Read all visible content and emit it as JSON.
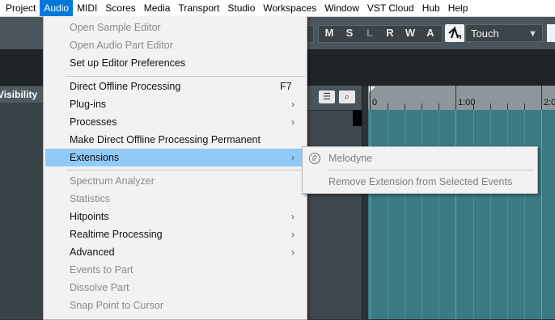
{
  "menubar": {
    "items": [
      "Project",
      "Audio",
      "MIDI",
      "Scores",
      "Media",
      "Transport",
      "Studio",
      "Workspaces",
      "Window",
      "VST Cloud",
      "Hub",
      "Help"
    ],
    "active_index": 1
  },
  "toolbar": {
    "buttons": [
      "M",
      "S",
      "L",
      "R",
      "W",
      "A"
    ],
    "automation_mode": "Touch"
  },
  "left_panel": {
    "visibility_label": "Visibility"
  },
  "ruler": {
    "labels": [
      "0",
      "1:00",
      "2:0"
    ]
  },
  "audio_menu": {
    "items": [
      {
        "label": "Open Sample Editor",
        "enabled": false,
        "submenu": false
      },
      {
        "label": "Open Audio Part Editor",
        "enabled": false,
        "submenu": false
      },
      {
        "label": "Set up Editor Preferences",
        "enabled": true,
        "submenu": false
      },
      {
        "label": "Direct Offline Processing",
        "enabled": true,
        "submenu": false,
        "shortcut": "F7"
      },
      {
        "label": "Plug-ins",
        "enabled": true,
        "submenu": true
      },
      {
        "label": "Processes",
        "enabled": true,
        "submenu": true
      },
      {
        "label": "Make Direct Offline Processing Permanent",
        "enabled": true,
        "submenu": false
      },
      {
        "label": "Extensions",
        "enabled": true,
        "submenu": true,
        "highlighted": true
      },
      {
        "label": "Spectrum Analyzer",
        "enabled": false,
        "submenu": false
      },
      {
        "label": "Statistics",
        "enabled": false,
        "submenu": false
      },
      {
        "label": "Hitpoints",
        "enabled": true,
        "submenu": true
      },
      {
        "label": "Realtime Processing",
        "enabled": true,
        "submenu": true
      },
      {
        "label": "Advanced",
        "enabled": true,
        "submenu": true
      },
      {
        "label": "Events to Part",
        "enabled": false,
        "submenu": false
      },
      {
        "label": "Dissolve Part",
        "enabled": false,
        "submenu": false
      },
      {
        "label": "Snap Point to Cursor",
        "enabled": false,
        "submenu": false
      }
    ]
  },
  "extensions_submenu": {
    "items": [
      {
        "label": "Melodyne",
        "icon": "melodyne-icon",
        "enabled": false
      },
      {
        "label": "Remove Extension from Selected Events",
        "enabled": false
      }
    ]
  },
  "colors": {
    "menu_highlight": "#91c9f7",
    "menubar_active": "#0078d7",
    "timeline": "#3a7a83"
  }
}
